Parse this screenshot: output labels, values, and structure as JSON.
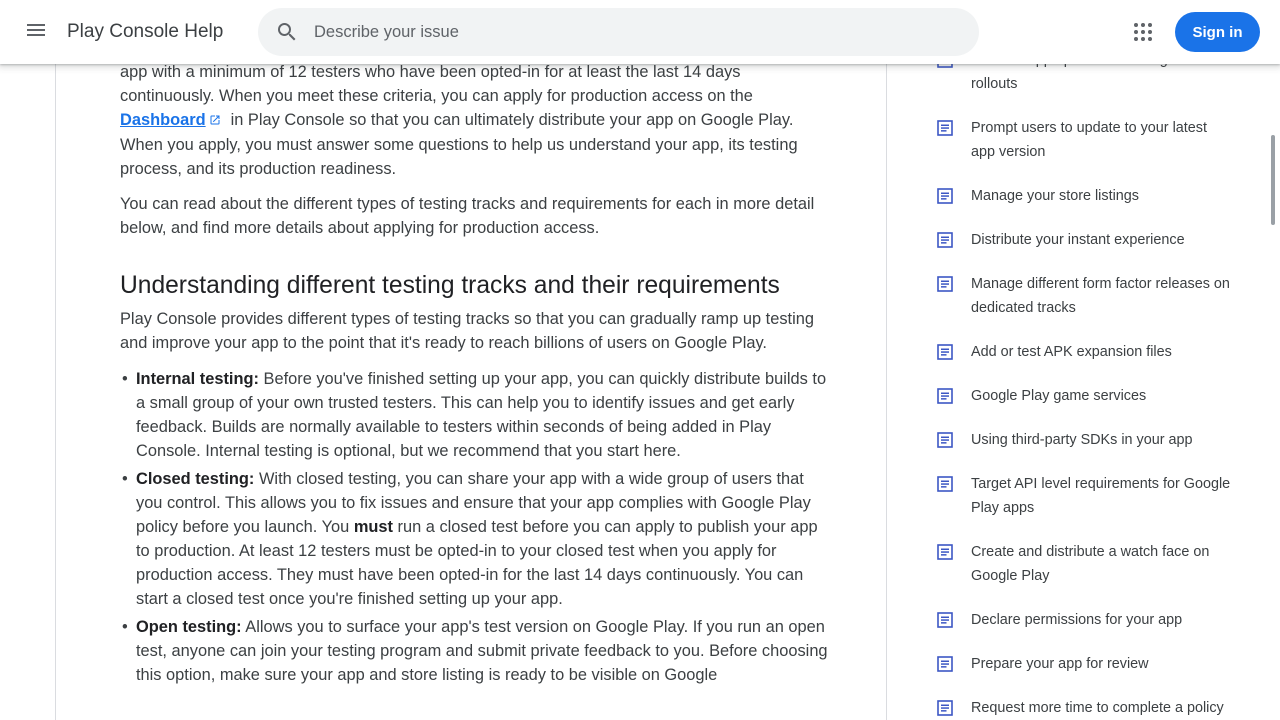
{
  "header": {
    "product_name": "Play Console Help",
    "search_placeholder": "Describe your issue",
    "signin_label": "Sign in"
  },
  "article": {
    "p1_before_link": "app with a minimum of 12 testers who have been opted-in for at least the last 14 days continuously. When you meet these criteria, you can apply for production access on the",
    "p1_link": "Dashboard",
    "p1_after_link": "in Play Console so that you can ultimately distribute your app on Google Play. When you apply, you must answer some questions to help us understand your app, its testing process, and its production readiness.",
    "p2": "You can read about the different types of testing tracks and requirements for each in more detail below, and find more details about applying for production access.",
    "heading": "Understanding different testing tracks and their requirements",
    "p3": "Play Console provides different types of testing tracks so that you can gradually ramp up testing and improve your app to the point that it's ready to reach billions of users on Google Play.",
    "bullets": [
      {
        "term": "Internal testing:",
        "text": "Before you've finished setting up your app, you can quickly distribute builds to a small group of your own trusted testers. This can help you to identify issues and get early feedback. Builds are normally available to testers within seconds of being added in Play Console. Internal testing is optional, but we recommend that you start here."
      },
      {
        "term": "Closed testing:",
        "text_before": "With closed testing, you can share your app with a wide group of users that you control. This allows you to fix issues and ensure that your app complies with Google Play policy before you launch. You",
        "emphasis": "must",
        "text_after": "run a closed test before you can apply to publish your app to production. At least 12 testers must be opted-in to your closed test when you apply for production access. They must have been opted-in for the last 14 days continuously. You can start a closed test once you're finished setting up your app."
      },
      {
        "term": "Open testing:",
        "text": "Allows you to surface your app's test version on Google Play. If you run an open test, anyone can join your testing program and submit private feedback to you. Before choosing this option, make sure your app and store listing is ready to be visible on Google"
      }
    ]
  },
  "sidebar": {
    "items": [
      {
        "label": "Release app updates with staged rollouts"
      },
      {
        "label": "Prompt users to update to your latest app version"
      },
      {
        "label": "Manage your store listings"
      },
      {
        "label": "Distribute your instant experience"
      },
      {
        "label": "Manage different form factor releases on dedicated tracks"
      },
      {
        "label": "Add or test APK expansion files"
      },
      {
        "label": "Google Play game services"
      },
      {
        "label": "Using third-party SDKs in your app"
      },
      {
        "label": "Target API level requirements for Google Play apps"
      },
      {
        "label": "Create and distribute a watch face on Google Play"
      },
      {
        "label": "Declare permissions for your app"
      },
      {
        "label": "Prepare your app for review"
      },
      {
        "label": "Request more time to complete a policy"
      }
    ]
  },
  "colors": {
    "accent": "#1a73e8",
    "icon": "#3c57c4",
    "search_bg": "#f1f3f4"
  }
}
